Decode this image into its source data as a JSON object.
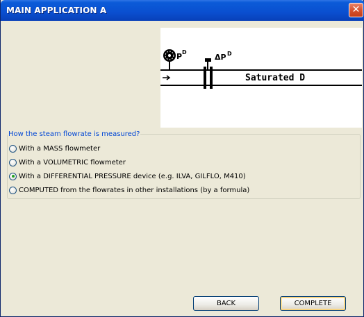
{
  "window": {
    "title": "MAIN APPLICATION A",
    "close_glyph": "✕"
  },
  "diagram": {
    "label": "Saturated D",
    "pressure_label": "P",
    "dp_label": "ΔP"
  },
  "question": {
    "legend": "How the steam flowrate is measured?",
    "options": [
      {
        "label": "With a MASS flowmeter",
        "selected": false
      },
      {
        "label": "With a VOLUMETRIC flowmeter",
        "selected": false
      },
      {
        "label": "With a DIFFERENTIAL PRESSURE device (e.g. ILVA, GILFLO, M410)",
        "selected": true
      },
      {
        "label": "COMPUTED from the flowrates in other installations (by a formula)",
        "selected": false
      }
    ]
  },
  "buttons": {
    "back": "BACK",
    "complete": "COMPLETE"
  },
  "colors": {
    "title_bar": "#0a4fd0",
    "legend_text": "#0046d5",
    "selected_radio": "#21a121"
  }
}
